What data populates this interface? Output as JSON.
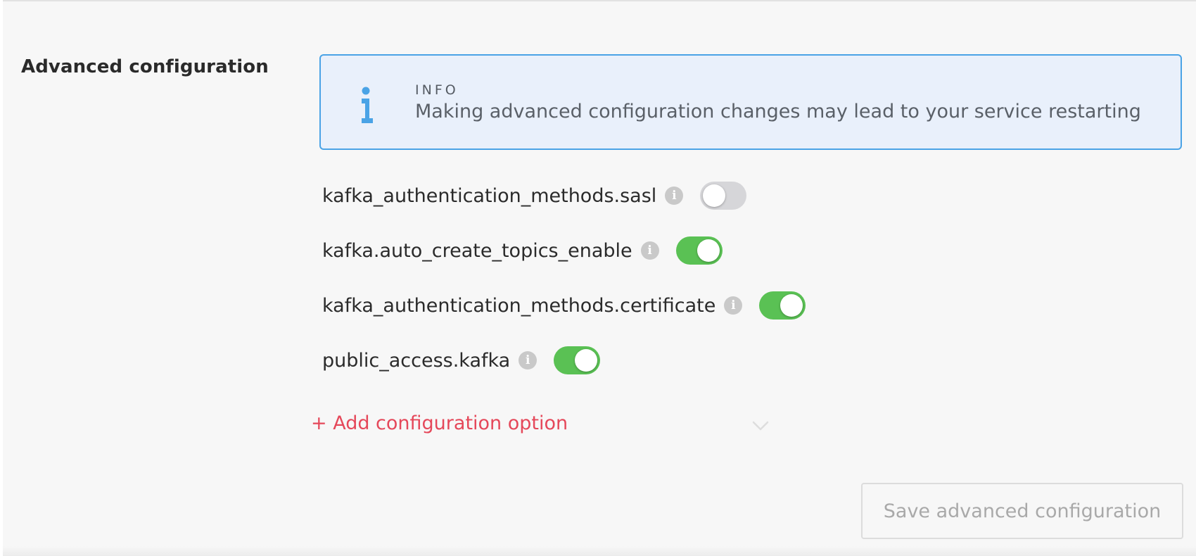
{
  "section": {
    "title": "Advanced configuration"
  },
  "info": {
    "icon": "info-icon",
    "label": "INFO",
    "message": "Making advanced configuration changes may lead to your service restarting"
  },
  "options": [
    {
      "key": "kafka_authentication_methods.sasl",
      "enabled": false
    },
    {
      "key": "kafka.auto_create_topics_enable",
      "enabled": true
    },
    {
      "key": "kafka_authentication_methods.certificate",
      "enabled": true
    },
    {
      "key": "public_access.kafka",
      "enabled": true
    }
  ],
  "add_option": {
    "label": "+ Add configuration option"
  },
  "save_button": {
    "label": "Save advanced configuration",
    "disabled": true
  },
  "colors": {
    "toggle_on": "#5ac154",
    "toggle_off": "#d6d6d9",
    "accent_red": "#e5485a",
    "info_border": "#4aa3e6",
    "info_background": "#e9f0fb"
  }
}
